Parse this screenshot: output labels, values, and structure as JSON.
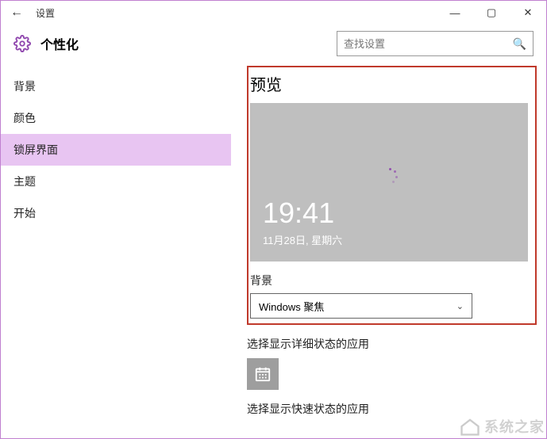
{
  "window": {
    "title": "设置",
    "minimize": "—",
    "maximize": "▢",
    "close": "✕",
    "back": "←"
  },
  "header": {
    "page_title": "个性化",
    "search_placeholder": "查找设置"
  },
  "sidebar": {
    "items": [
      {
        "label": "背景",
        "selected": false
      },
      {
        "label": "颜色",
        "selected": false
      },
      {
        "label": "锁屏界面",
        "selected": true
      },
      {
        "label": "主题",
        "selected": false
      },
      {
        "label": "开始",
        "selected": false
      }
    ]
  },
  "main": {
    "preview_heading": "预览",
    "preview": {
      "time": "19:41",
      "date": "11月28日, 星期六"
    },
    "background_label": "背景",
    "background_dropdown": {
      "selected": "Windows 聚焦"
    },
    "detailed_status_label": "选择显示详细状态的应用",
    "detailed_app_icon": "calendar-icon",
    "quick_status_label": "选择显示快速状态的应用"
  },
  "watermark": "系统之家"
}
